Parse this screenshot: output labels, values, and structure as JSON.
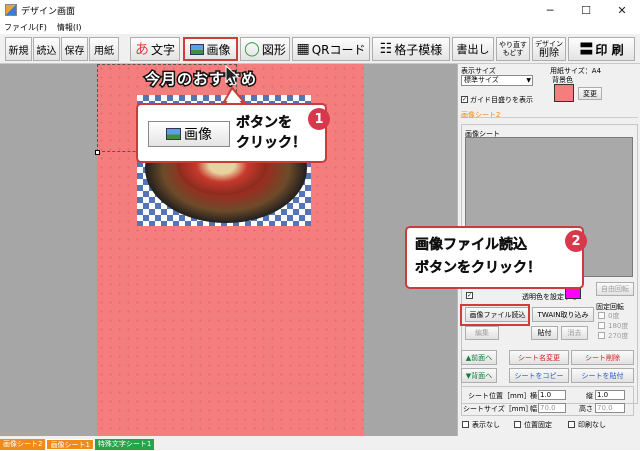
{
  "window": {
    "title": "デザイン画面",
    "minimize": "─",
    "maximize": "☐",
    "close": "✕"
  },
  "menu": [
    "ファイル(F)",
    "情報(I)"
  ],
  "toolbar": {
    "new": "新規",
    "open": "読込",
    "save": "保存",
    "paper": "用紙",
    "text": "文字",
    "text_icon": "あ",
    "image": "画像",
    "shape": "図形",
    "qrcode": "QRコード",
    "grid": "格子模様",
    "output": "書出し",
    "redo_top": "やり直す",
    "redo_bottom": "もどす",
    "delete_top": "デザイン",
    "delete": "削除",
    "print": "印 刷"
  },
  "canvas": {
    "headline": "今月のおすすめ"
  },
  "callouts": {
    "one": {
      "badge": "1",
      "button_label": "画像",
      "line1": "ボタンを",
      "line2": "クリック！"
    },
    "two": {
      "badge": "2",
      "line1": "画像ファイル読込",
      "line2": "ボタンをクリック！"
    }
  },
  "panel": {
    "display_size_label": "表示サイズ",
    "display_size_value": "標準サイズ",
    "paper_size_label": "用紙サイズ：A4",
    "bg_color_label": "背景色",
    "change_button": "変更",
    "guide_checkbox": "ガイド目盛りを表示",
    "section_title": "画像シート2",
    "image_sheet_label": "画像シート",
    "transparent_label": "透明色を設定する",
    "free_rotate": "自由回転",
    "load_image": "画像ファイル読込",
    "twain": "TWAIN取り込み",
    "edit": "編集",
    "paste": "貼付",
    "erase": "消去",
    "fixed_rotate": "固定回転",
    "rot_0": "0度",
    "rot_180": "180度",
    "rot_270": "270度",
    "front": "▲前面へ",
    "back": "▼背面へ",
    "rename_sheet": "シート名変更",
    "delete_sheet": "シート削除",
    "copy_sheet": "シートをコピー",
    "paste_sheet": "シートを貼付",
    "pos_label": "シート位置［mm］",
    "size_label": "シートサイズ［mm］",
    "horizontal": "横",
    "vertical": "縦",
    "width": "幅",
    "height": "高さ",
    "pos_x": "1.0",
    "pos_y": "1.0",
    "size_w": "70.0",
    "size_h": "70.0",
    "hide": "表示なし",
    "lock_pos": "位置固定",
    "no_print": "印刷なし"
  },
  "tabs": [
    {
      "label": "画像シート2",
      "color": "#f08a18"
    },
    {
      "label": "画像シート1",
      "color": "#f08a18"
    },
    {
      "label": "特殊文字シート1",
      "color": "#27a34a"
    }
  ],
  "colors": {
    "page": "#f47d7d",
    "accent_red": "#d8384b",
    "bg_swatch": "#f47d7d",
    "transparent_swatch": "#ff00ff"
  }
}
